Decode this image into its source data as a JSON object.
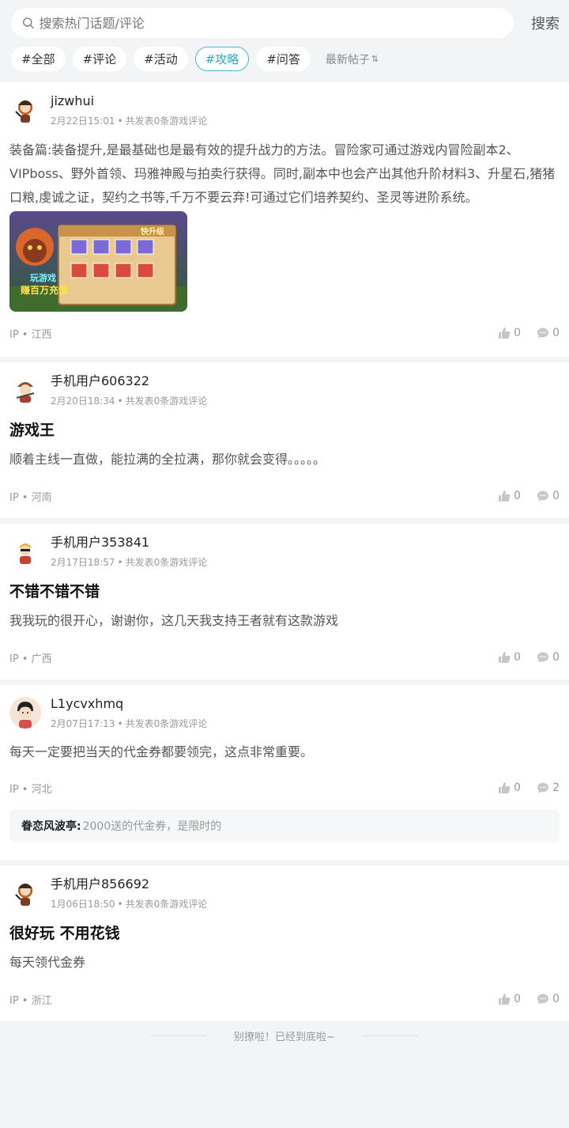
{
  "search": {
    "placeholder": "搜索热门话题/评论",
    "button": "搜索"
  },
  "filters": [
    "#全部",
    "#评论",
    "#活动",
    "#攻略",
    "#问答"
  ],
  "sort_label": "最新帖子",
  "posts": [
    {
      "user": "jizwhui",
      "date": "2月22日15:01",
      "meta": "共发表0条游戏评论",
      "title": "",
      "body": "装备篇:装备提升,是最基础也是最有效的提升战力的方法。冒险家可通过游戏内冒险副本2、VIPboss、野外首领、玛雅神殿与拍卖行获得。同时,副本中也会产出其他升阶材料3、升星石,猪猪口粮,虔诚之证，契约之书等,千万不要云弃!可通过它们培养契约、圣灵等进阶系统。",
      "image_caption_1": "快升级",
      "image_caption_2": "玩游戏",
      "image_caption_3": "赚百万充值",
      "ip": "IP • 江西",
      "likes": "0",
      "comments": "0"
    },
    {
      "user": "手机用户606322",
      "date": "2月20日18:34",
      "meta": "共发表0条游戏评论",
      "title": "游戏王",
      "body": "顺着主线一直做，能拉满的全拉满，那你就会变得。。。。。",
      "ip": "IP • 河南",
      "likes": "0",
      "comments": "0"
    },
    {
      "user": "手机用户353841",
      "date": "2月17日18:57",
      "meta": "共发表0条游戏评论",
      "title": "不错不错不错",
      "body": "我我玩的很开心，谢谢你，这几天我支持王者就有这款游戏",
      "ip": "IP • 广西",
      "likes": "0",
      "comments": "0"
    },
    {
      "user": "L1ycvxhmq",
      "date": "2月07日17:13",
      "meta": "共发表0条游戏评论",
      "title": "",
      "body": "每天一定要把当天的代金券都要领完，这点非常重要。",
      "ip": "IP • 河北",
      "likes": "0",
      "comments": "2",
      "reply_name": "眷恋风波亭:",
      "reply_text": "2000送的代金券，是限时的"
    },
    {
      "user": "手机用户856692",
      "date": "1月06日18:50",
      "meta": "共发表0条游戏评论",
      "title": "很好玩 不用花钱",
      "body": "每天领代金券",
      "ip": "IP • 浙江",
      "likes": "0",
      "comments": "0"
    }
  ],
  "end_text": "别撩啦！已经到底啦~",
  "colors": {
    "accent": "#3aa6ba",
    "background": "#f3f4f6"
  },
  "icons": {
    "search": "search-icon",
    "like": "thumb-up-icon",
    "comment": "comment-bubble-icon",
    "sort": "sort-arrows-icon"
  }
}
